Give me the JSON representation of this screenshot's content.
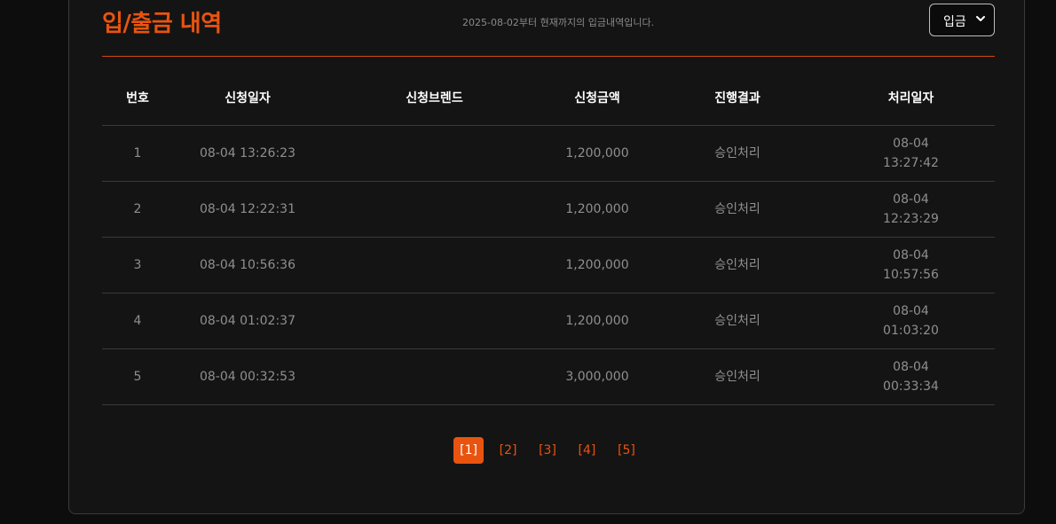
{
  "header": {
    "title": "입/출금 내역",
    "subtitle": "2025-08-02부터 현재까지의 입금내역입니다.",
    "filter_selected": "입금"
  },
  "table": {
    "columns": [
      "번호",
      "신청일자",
      "신청브렌드",
      "신청금액",
      "진행결과",
      "처리일자"
    ],
    "rows": [
      {
        "no": "1",
        "date": "08-04 13:26:23",
        "brand": "",
        "amount": "1,200,000",
        "result": "승인처리",
        "proc_date": "08-04",
        "proc_time": "13:27:42"
      },
      {
        "no": "2",
        "date": "08-04 12:22:31",
        "brand": "",
        "amount": "1,200,000",
        "result": "승인처리",
        "proc_date": "08-04",
        "proc_time": "12:23:29"
      },
      {
        "no": "3",
        "date": "08-04 10:56:36",
        "brand": "",
        "amount": "1,200,000",
        "result": "승인처리",
        "proc_date": "08-04",
        "proc_time": "10:57:56"
      },
      {
        "no": "4",
        "date": "08-04 01:02:37",
        "brand": "",
        "amount": "1,200,000",
        "result": "승인처리",
        "proc_date": "08-04",
        "proc_time": "01:03:20"
      },
      {
        "no": "5",
        "date": "08-04 00:32:53",
        "brand": "",
        "amount": "3,000,000",
        "result": "승인처리",
        "proc_date": "08-04",
        "proc_time": "00:33:34"
      }
    ]
  },
  "pagination": {
    "pages": [
      "[1]",
      "[2]",
      "[3]",
      "[4]",
      "[5]"
    ],
    "active_page": "[1]"
  },
  "colors": {
    "accent": "#e8540f",
    "background": "#141414"
  },
  "icons": {
    "filter_dropdown": "chevron-down-icon"
  }
}
